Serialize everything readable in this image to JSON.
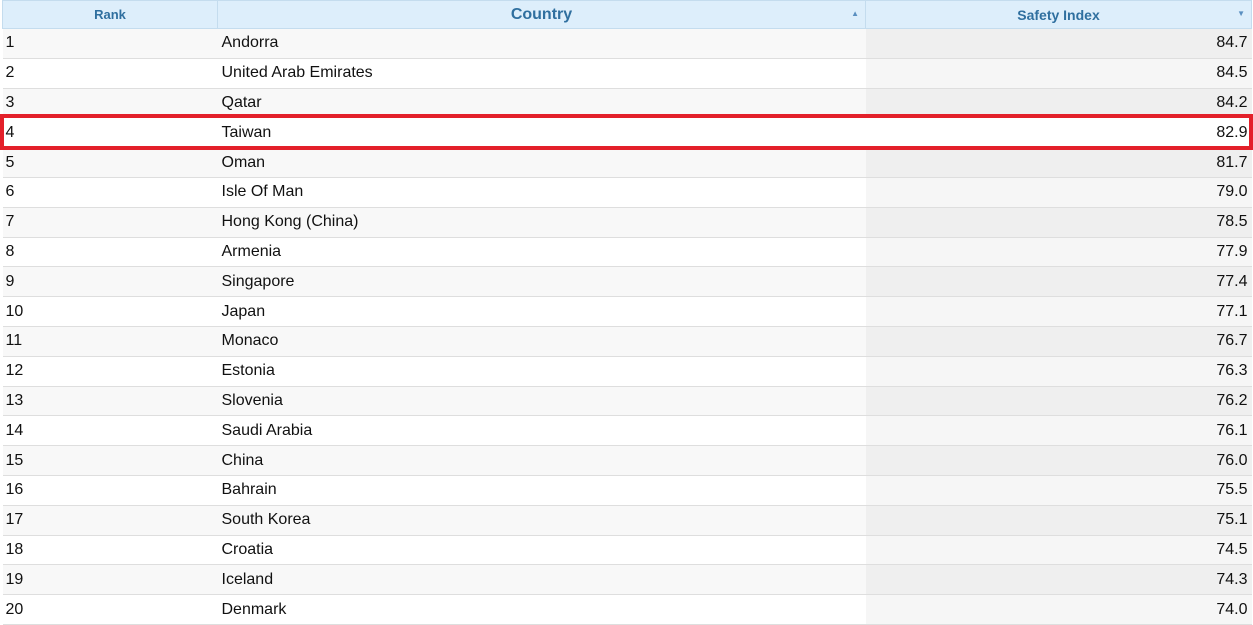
{
  "table": {
    "columns": [
      {
        "label": "Rank",
        "sort": ""
      },
      {
        "label": "Country",
        "sort": "▲"
      },
      {
        "label": "Safety Index",
        "sort": "▼"
      }
    ],
    "rows": [
      {
        "rank": "1",
        "country": "Andorra",
        "index": "84.7"
      },
      {
        "rank": "2",
        "country": "United Arab Emirates",
        "index": "84.5"
      },
      {
        "rank": "3",
        "country": "Qatar",
        "index": "84.2"
      },
      {
        "rank": "4",
        "country": "Taiwan",
        "index": "82.9"
      },
      {
        "rank": "5",
        "country": "Oman",
        "index": "81.7"
      },
      {
        "rank": "6",
        "country": "Isle Of Man",
        "index": "79.0"
      },
      {
        "rank": "7",
        "country": "Hong Kong (China)",
        "index": "78.5"
      },
      {
        "rank": "8",
        "country": "Armenia",
        "index": "77.9"
      },
      {
        "rank": "9",
        "country": "Singapore",
        "index": "77.4"
      },
      {
        "rank": "10",
        "country": "Japan",
        "index": "77.1"
      },
      {
        "rank": "11",
        "country": "Monaco",
        "index": "76.7"
      },
      {
        "rank": "12",
        "country": "Estonia",
        "index": "76.3"
      },
      {
        "rank": "13",
        "country": "Slovenia",
        "index": "76.2"
      },
      {
        "rank": "14",
        "country": "Saudi Arabia",
        "index": "76.1"
      },
      {
        "rank": "15",
        "country": "China",
        "index": "76.0"
      },
      {
        "rank": "16",
        "country": "Bahrain",
        "index": "75.5"
      },
      {
        "rank": "17",
        "country": "South Korea",
        "index": "75.1"
      },
      {
        "rank": "18",
        "country": "Croatia",
        "index": "74.5"
      },
      {
        "rank": "19",
        "country": "Iceland",
        "index": "74.3"
      },
      {
        "rank": "20",
        "country": "Denmark",
        "index": "74.0"
      }
    ],
    "highlighted_row": 3
  },
  "colors": {
    "header_background": "#ddeefb",
    "header_text": "#2f6f9f",
    "highlight_border": "#e3202a"
  }
}
